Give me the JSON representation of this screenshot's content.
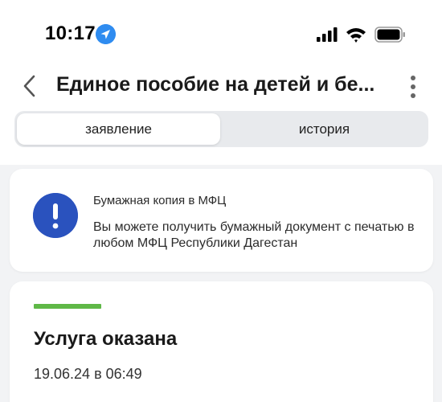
{
  "status_bar": {
    "time": "10:17"
  },
  "header": {
    "title": "Единое пособие на детей и бе..."
  },
  "tabs": [
    {
      "label": "заявление",
      "active": true
    },
    {
      "label": "история",
      "active": false
    }
  ],
  "info_card": {
    "title": "Бумажная копия в МФЦ",
    "text": "Вы можете получить бумажный документ с печатью в любом МФЦ Республики Дагестан"
  },
  "status_card": {
    "status": "Услуга оказана",
    "date": "19.06.24 в 06:49"
  },
  "colors": {
    "accent_blue": "#2a52be",
    "location_blue": "#2f8cf0",
    "status_green": "#5fb847",
    "background": "#f2f3f5"
  },
  "icons": {
    "back": "chevron-left-icon",
    "more": "more-vertical-icon",
    "alert": "exclamation-icon",
    "location": "location-arrow-icon",
    "signal": "cellular-signal-icon",
    "wifi": "wifi-icon",
    "battery": "battery-icon"
  }
}
